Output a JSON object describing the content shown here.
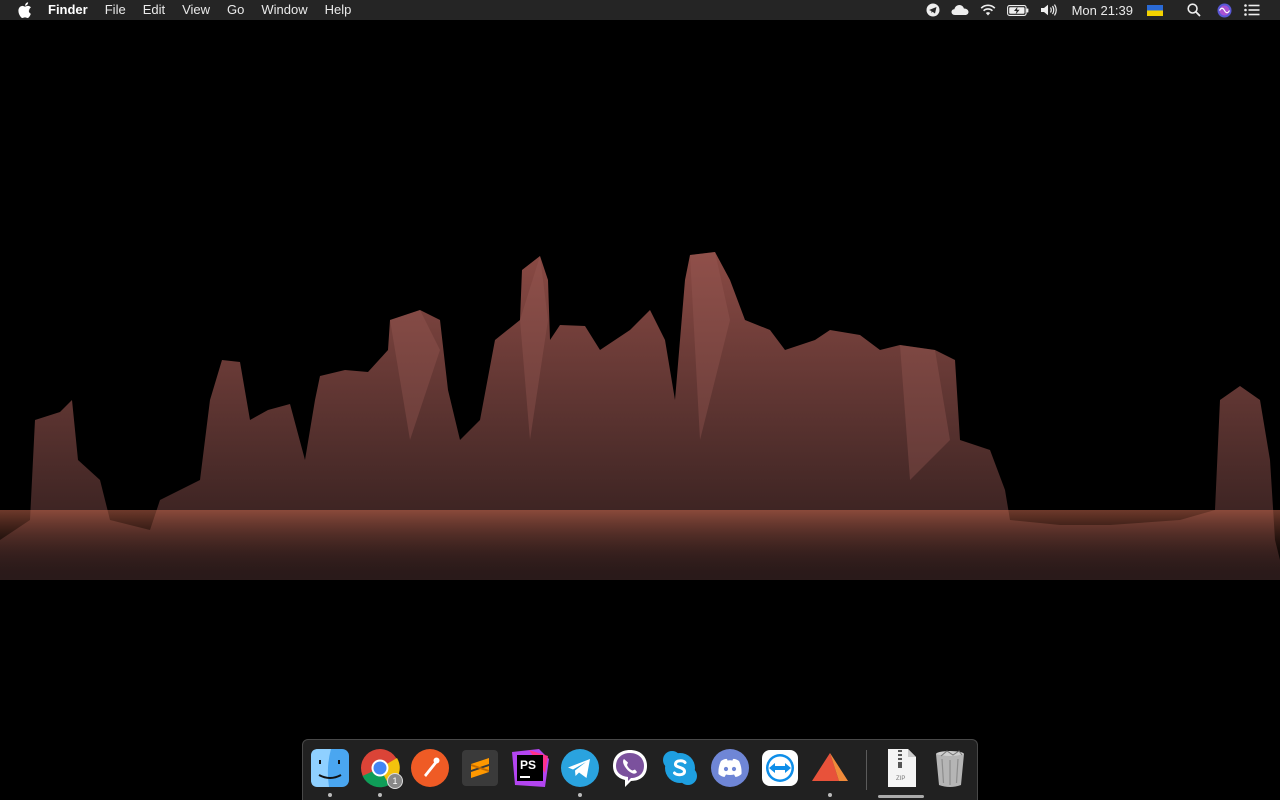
{
  "menubar": {
    "app_name": "Finder",
    "items": [
      "File",
      "Edit",
      "View",
      "Go",
      "Window",
      "Help"
    ],
    "clock": "Mon 21:39"
  },
  "status_icons": [
    "telegram-status-icon",
    "cloud-icon",
    "wifi-icon",
    "battery-charging-icon",
    "volume-icon",
    "ukraine-flag-icon",
    "search-icon",
    "siri-icon",
    "notification-center-icon"
  ],
  "dock": {
    "apps": [
      {
        "name": "Finder",
        "running": true
      },
      {
        "name": "Google Chrome",
        "running": true,
        "badge": "1"
      },
      {
        "name": "Postman",
        "running": false
      },
      {
        "name": "Sublime Text",
        "running": false
      },
      {
        "name": "PhpStorm",
        "running": false,
        "label": "PS"
      },
      {
        "name": "Telegram",
        "running": true
      },
      {
        "name": "Viber",
        "running": false
      },
      {
        "name": "Skype",
        "running": false
      },
      {
        "name": "Discord",
        "running": false
      },
      {
        "name": "TeamViewer",
        "running": false
      },
      {
        "name": "Parallels",
        "running": true
      }
    ],
    "files": [
      {
        "name": "zip-archive",
        "label": "ZIP"
      },
      {
        "name": "Trash"
      }
    ]
  },
  "colors": {
    "menubar_bg": "#282828",
    "wallpaper_bg": "#000000",
    "rock": "#6a3a35",
    "grass": "#b35a44"
  }
}
